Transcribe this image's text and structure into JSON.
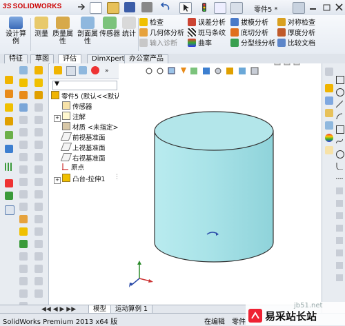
{
  "app": {
    "logo_prefix": "3S",
    "logo_text": "SOLIDWORKS",
    "doc_title": "零件5 *"
  },
  "ribbon": {
    "design_study": "设计算例",
    "measure": "测量",
    "mass_props": "质量属性",
    "section_props": "剖面属性",
    "sensor": "传感器",
    "statistics": "统计",
    "check": "检查",
    "geometry_analysis": "几何体分析",
    "import_diagnostics": "输入诊断",
    "deviation": "误差分析",
    "zebra": "斑马条纹",
    "curvature": "曲率",
    "draft": "拔模分析",
    "undercut": "底切分析",
    "parting_line": "分型线分析",
    "symmetry": "对称检查",
    "thickness": "厚度分析",
    "compare": "比较文档"
  },
  "tabs": [
    "特征",
    "草图",
    "评估",
    "DimXpert",
    "办公室产品"
  ],
  "active_tab": 2,
  "tree": {
    "root": "零件5 (默认<<默认",
    "items": [
      {
        "label": "传感器"
      },
      {
        "label": "注解"
      },
      {
        "label": "材质 <未指定>"
      },
      {
        "label": "前视基准面"
      },
      {
        "label": "上视基准面"
      },
      {
        "label": "右视基准面"
      },
      {
        "label": "原点"
      },
      {
        "label": "凸台-拉伸1"
      }
    ]
  },
  "bottom_tabs": [
    "模型",
    "运动算例 1"
  ],
  "status": {
    "product": "SolidWorks Premium 2013 x64 版",
    "mode": "在编辑",
    "doc": "零件",
    "watermark_url": "jb51.net",
    "watermark_text": "易采站长站"
  },
  "colors": {
    "cylinder": "#a9e3e8",
    "accent": "#d11"
  }
}
